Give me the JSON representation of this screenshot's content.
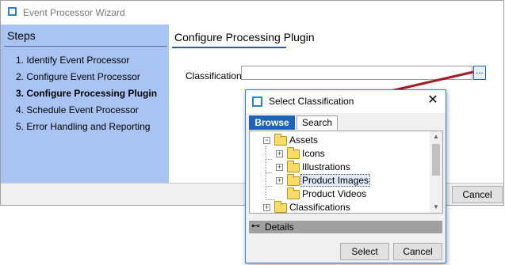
{
  "wizard": {
    "title": "Event Processor Wizard",
    "steps_header": "Steps",
    "steps": [
      {
        "label": "1. Identify Event Processor"
      },
      {
        "label": "2. Configure Event Processor"
      },
      {
        "label": "3. Configure Processing Plugin"
      },
      {
        "label": "4. Schedule Event Processor"
      },
      {
        "label": "5. Error Handling and Reporting"
      }
    ],
    "active_step_index": 2,
    "page_title": "Configure Processing Plugin",
    "classification_label": "Classification",
    "classification_value": "",
    "browse_button_label": "...",
    "cancel_label": "Cancel"
  },
  "dialog": {
    "title": "Select Classification",
    "close_glyph": "✕",
    "tabs": [
      {
        "label": "Browse",
        "active": true
      },
      {
        "label": "Search",
        "active": false
      }
    ],
    "tree": [
      {
        "label": "Assets",
        "expander": "−"
      },
      {
        "label": "Icons",
        "expander": "+"
      },
      {
        "label": "Illustrations",
        "expander": "+"
      },
      {
        "label": "Product Images",
        "expander": "+",
        "selected": true
      },
      {
        "label": "Product Videos",
        "expander": ""
      },
      {
        "label": "Classifications",
        "expander": "+"
      }
    ],
    "scroll_up_glyph": "▲",
    "scroll_down_glyph": "▼",
    "details_label": "Details",
    "details_icon_glyph": "⊷",
    "select_label": "Select",
    "cancel_label": "Cancel"
  },
  "colors": {
    "steps_background": "#a9c4f2",
    "accent_blue": "#2b7fd6",
    "annotation_arrow": "#a31e24"
  }
}
